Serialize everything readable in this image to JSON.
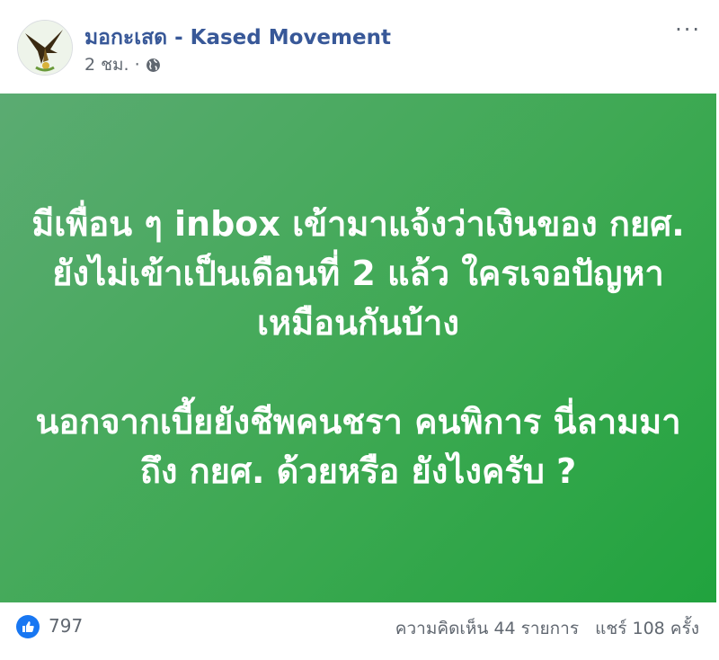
{
  "post": {
    "page_name": "มอกะเสด - Kased Movement",
    "time": "2 ชม.",
    "separator": "·",
    "text": {
      "paragraph_1": "มีเพื่อน ๆ inbox เข้ามาแจ้งว่าเงินของ กยศ. ยังไม่เข้าเป็นเดือนที่ 2 แล้ว ใครเจอปัญหาเหมือนกันบ้าง",
      "paragraph_2": "นอกจากเบี้ยยังชีพคนชรา คนพิการ นี่ลามมาถึง กยศ. ด้วยหรือ ยังไงครับ ?"
    },
    "background_colors": [
      "#5bab72",
      "#21a33e"
    ]
  },
  "footer": {
    "reaction_count": "797",
    "comments": "ความคิดเห็น 44 รายการ",
    "shares": "แชร์ 108 ครั้ง"
  },
  "icons": [
    "avatar-logo",
    "globe-icon",
    "more-options-icon",
    "like-icon"
  ],
  "colors": {
    "link": "#385898",
    "meta": "#606770",
    "like": "#1877f2"
  }
}
